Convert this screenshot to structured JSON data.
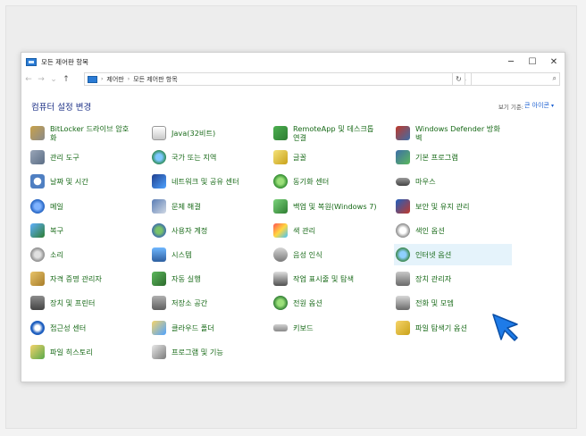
{
  "window": {
    "title": "모든 제어판 항목",
    "controls": {
      "minimize": "─",
      "maximize": "☐",
      "close": "✕"
    }
  },
  "nav": {
    "back": "←",
    "forward": "→",
    "dropdown": "⌄",
    "up": "↑"
  },
  "address": {
    "crumbs": [
      "제어판",
      "모든 제어판 항목"
    ],
    "separator": "›",
    "dropdown": "⌄",
    "refresh": "↻"
  },
  "search": {
    "placeholder": "",
    "icon": "⌕"
  },
  "page": {
    "heading": "컴퓨터 설정 변경",
    "view_by_label": "보기 기준:",
    "view_by_value": "큰 아이콘",
    "view_by_arrow": "▾"
  },
  "columns": [
    [
      {
        "label": "BitLocker 드라이브 암호\n화",
        "icon": "bitlocker-icon"
      },
      {
        "label": "관리 도구",
        "icon": "admin-tools-icon"
      },
      {
        "label": "날짜 및 시간",
        "icon": "date-time-icon"
      },
      {
        "label": "메일",
        "icon": "mail-icon"
      },
      {
        "label": "복구",
        "icon": "recovery-icon"
      },
      {
        "label": "소리",
        "icon": "sound-icon"
      },
      {
        "label": "자격 증명 관리자",
        "icon": "credential-manager-icon"
      },
      {
        "label": "장치 및 프린터",
        "icon": "devices-printers-icon"
      },
      {
        "label": "접근성 센터",
        "icon": "ease-of-access-icon"
      },
      {
        "label": "파일 히스토리",
        "icon": "file-history-icon"
      }
    ],
    [
      {
        "label": "Java(32비트)",
        "icon": "java-icon"
      },
      {
        "label": "국가 또는 지역",
        "icon": "region-icon"
      },
      {
        "label": "네트워크 및 공유 센터",
        "icon": "network-icon"
      },
      {
        "label": "문제 해결",
        "icon": "troubleshooting-icon"
      },
      {
        "label": "사용자 계정",
        "icon": "user-accounts-icon"
      },
      {
        "label": "시스템",
        "icon": "system-icon"
      },
      {
        "label": "자동 실행",
        "icon": "autoplay-icon"
      },
      {
        "label": "저장소 공간",
        "icon": "storage-spaces-icon"
      },
      {
        "label": "클라우드 폴더",
        "icon": "cloud-folder-icon"
      },
      {
        "label": "프로그램 및 기능",
        "icon": "programs-features-icon"
      }
    ],
    [
      {
        "label": "RemoteApp 및 데스크톱\n연결",
        "icon": "remoteapp-icon"
      },
      {
        "label": "글꼴",
        "icon": "fonts-icon"
      },
      {
        "label": "동기화 센터",
        "icon": "sync-center-icon"
      },
      {
        "label": "백업 및 복원(Windows 7)",
        "icon": "backup-restore-icon"
      },
      {
        "label": "색 관리",
        "icon": "color-management-icon"
      },
      {
        "label": "음성 인식",
        "icon": "speech-recognition-icon"
      },
      {
        "label": "작업 표시줄 및 탐색",
        "icon": "taskbar-icon"
      },
      {
        "label": "전원 옵션",
        "icon": "power-options-icon"
      },
      {
        "label": "키보드",
        "icon": "keyboard-icon"
      }
    ],
    [
      {
        "label": "Windows Defender 방화\n벽",
        "icon": "firewall-icon"
      },
      {
        "label": "기본 프로그램",
        "icon": "default-programs-icon"
      },
      {
        "label": "마우스",
        "icon": "mouse-icon"
      },
      {
        "label": "보안 및 유지 관리",
        "icon": "security-maintenance-icon"
      },
      {
        "label": "색인 옵션",
        "icon": "indexing-options-icon"
      },
      {
        "label": "인터넷 옵션",
        "icon": "internet-options-icon",
        "highlighted": true
      },
      {
        "label": "장치 관리자",
        "icon": "device-manager-icon"
      },
      {
        "label": "전화 및 모뎀",
        "icon": "phone-modem-icon"
      },
      {
        "label": "파일 탐색기 옵션",
        "icon": "file-explorer-options-icon"
      }
    ]
  ],
  "colors": {
    "link_green": "#1a6b1a",
    "heading_blue": "#1e3287",
    "highlight": "#e5f3fb",
    "cursor_blue": "#1e7be8"
  }
}
